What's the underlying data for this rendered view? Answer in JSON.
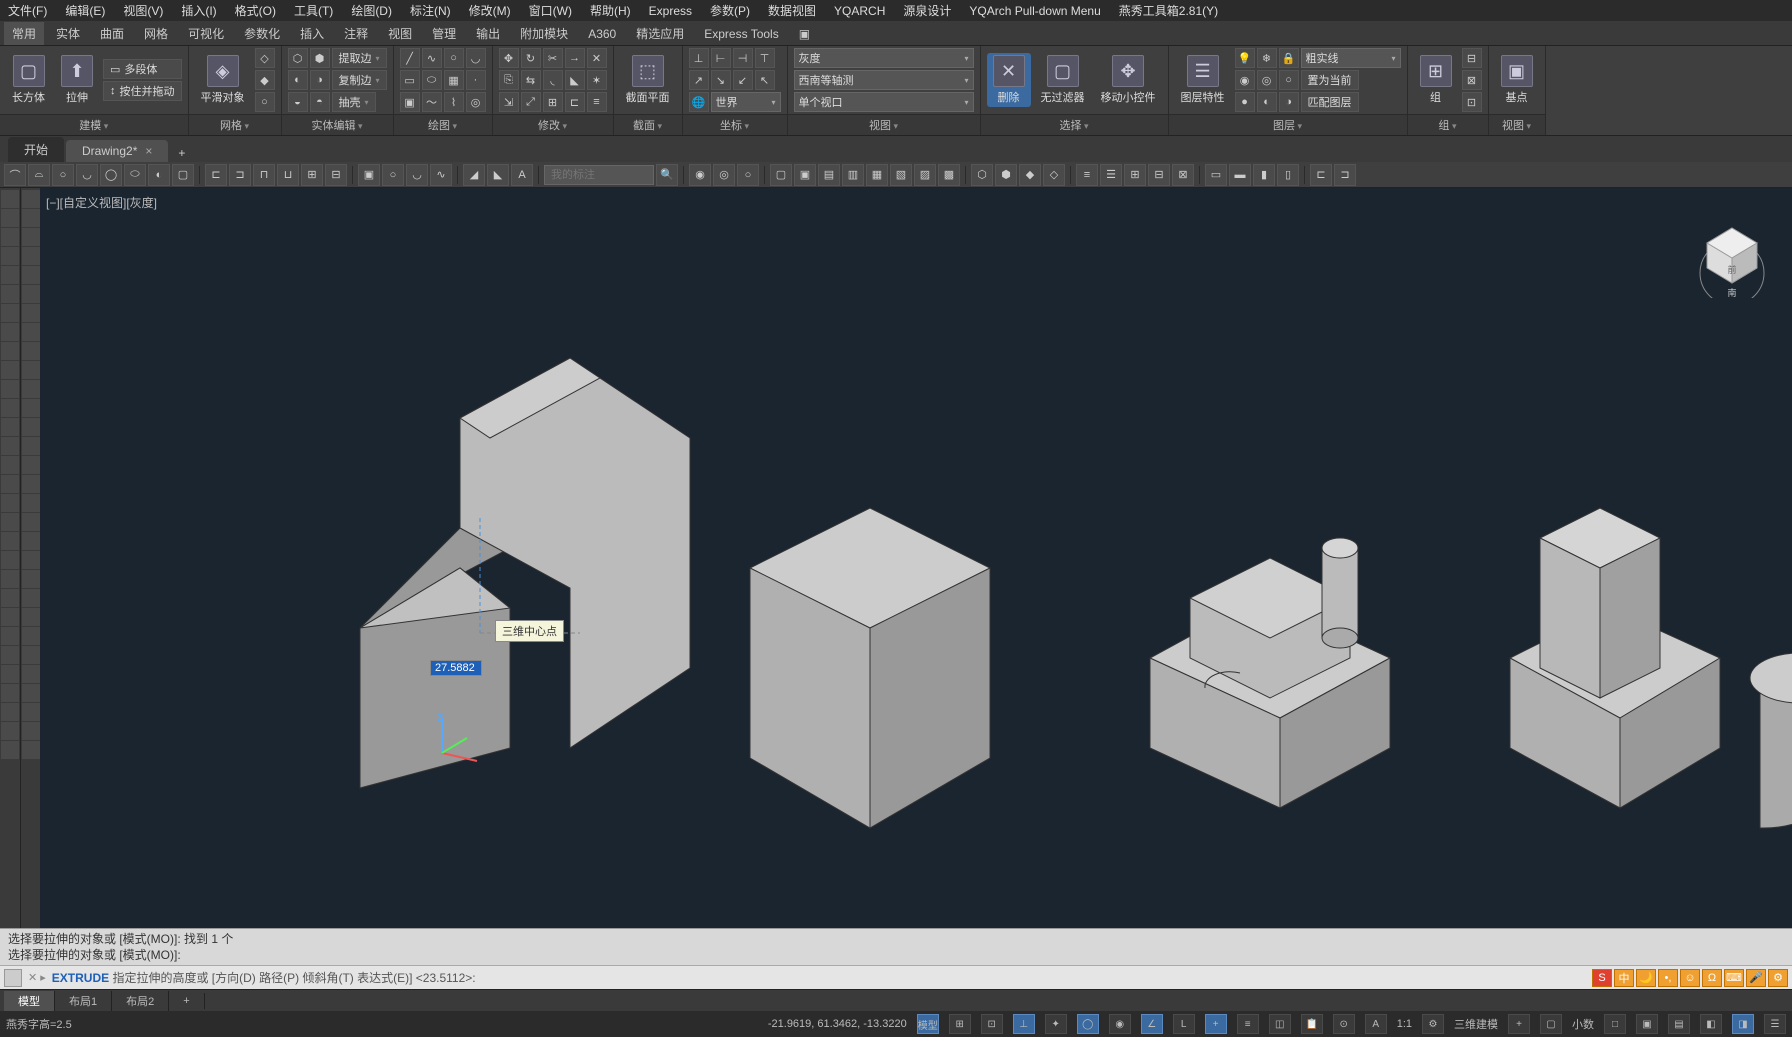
{
  "menubar": [
    "文件(F)",
    "编辑(E)",
    "视图(V)",
    "插入(I)",
    "格式(O)",
    "工具(T)",
    "绘图(D)",
    "标注(N)",
    "修改(M)",
    "窗口(W)",
    "帮助(H)",
    "Express",
    "参数(P)",
    "数据视图",
    "YQARCH",
    "源泉设计",
    "YQArch Pull-down Menu",
    "燕秀工具箱2.81(Y)"
  ],
  "ribbon_tabs": [
    "常用",
    "实体",
    "曲面",
    "网格",
    "可视化",
    "参数化",
    "插入",
    "注释",
    "视图",
    "管理",
    "输出",
    "附加模块",
    "A360",
    "精选应用",
    "Express Tools",
    "▣"
  ],
  "panels": {
    "p0": {
      "label": "建模",
      "btns": [
        "长方体",
        "拉伸"
      ],
      "side": [
        "多段体",
        "按住并拖动"
      ]
    },
    "p1": {
      "label": "网格",
      "btn": "平滑对象"
    },
    "p2": {
      "label": "实体编辑",
      "btns": [
        "提取边",
        "复制边",
        "抽壳"
      ]
    },
    "p3": {
      "label": "绘图"
    },
    "p4": {
      "label": "修改"
    },
    "p5": {
      "label": "截面",
      "btn": "截面平面"
    },
    "p6": {
      "label": "坐标",
      "world": "世界"
    },
    "p7": {
      "label": "视图",
      "dropdowns": [
        "灰度",
        "西南等轴测",
        "单个视口"
      ]
    },
    "p8": {
      "label": "选择",
      "b1": "删除",
      "b2": "无过滤器",
      "b3": "移动小控件"
    },
    "p9": {
      "label": "图层",
      "b": "图层特性",
      "items": [
        "粗实线",
        "置为当前",
        "匹配图层"
      ]
    },
    "p10": {
      "label": "组",
      "b": "组"
    },
    "p11": {
      "label": "视图",
      "b": "基点"
    }
  },
  "doc_tabs": {
    "t1": "开始",
    "t2": "Drawing2*"
  },
  "searchbox_ph": "我的标注",
  "vp_label": "[−][自定义视图][灰度]",
  "tooltip": "三维中心点",
  "input_value": "27.5882",
  "log": {
    "l1": "选择要拉伸的对象或 [模式(MO)]: 找到 1 个",
    "l2": "选择要拉伸的对象或 [模式(MO)]:"
  },
  "cmd": {
    "prefix": "✕ ▸",
    "kw": "EXTRUDE",
    "text": " 指定拉伸的高度或 [方向(D) 路径(P) 倾斜角(T) 表达式(E)] <23.5112>:"
  },
  "bottom_tabs": [
    "模型",
    "布局1",
    "布局2",
    "+"
  ],
  "statusbar": {
    "left": "燕秀字高=2.5",
    "coords": "-21.9619, 61.3462, -13.3220",
    "mode": "模型",
    "scale": "1:1",
    "style": "三维建模",
    "decimal": "小数"
  }
}
